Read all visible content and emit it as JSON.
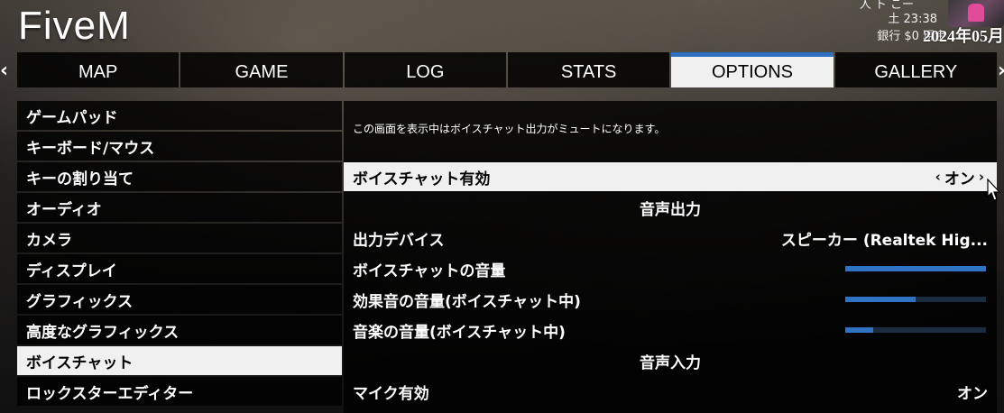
{
  "app": {
    "title": "FiveM"
  },
  "hud": {
    "player_name": "人 ト こー",
    "time": "土 23:38",
    "money": "銀行 $0  現金",
    "date_overlay": "2024年05月"
  },
  "tabs": [
    {
      "label": "MAP",
      "active": false
    },
    {
      "label": "GAME",
      "active": false
    },
    {
      "label": "LOG",
      "active": false
    },
    {
      "label": "STATS",
      "active": false
    },
    {
      "label": "OPTIONS",
      "active": true
    },
    {
      "label": "GALLERY",
      "active": false
    }
  ],
  "nav": {
    "left_arrow": "‹",
    "right_arrow": "›"
  },
  "sidebar": {
    "items": [
      {
        "label": "ゲームパッド"
      },
      {
        "label": "キーボード/マウス"
      },
      {
        "label": "キーの割り当て"
      },
      {
        "label": "オーディオ"
      },
      {
        "label": "カメラ"
      },
      {
        "label": "ディスプレイ"
      },
      {
        "label": "グラフィックス"
      },
      {
        "label": "高度なグラフィックス"
      },
      {
        "label": "ボイスチャット",
        "active": true
      },
      {
        "label": "ロックスターエディター"
      }
    ]
  },
  "panel": {
    "notice": "この画面を表示中はボイスチャット出力がミュートになります。",
    "voice_chat_enabled": {
      "label": "ボイスチャット有効",
      "value": "オン"
    },
    "output_section": "音声出力",
    "output_device": {
      "label": "出力デバイス",
      "value": "スピーカー (Realtek Hig..."
    },
    "voice_volume": {
      "label": "ボイスチャットの音量",
      "level": 1.0
    },
    "sfx_volume": {
      "label": "効果音の音量(ボイスチャット中)",
      "level": 0.5
    },
    "music_volume": {
      "label": "音楽の音量(ボイスチャット中)",
      "level": 0.2
    },
    "input_section": "音声入力",
    "mic_enabled": {
      "label": "マイク有効",
      "value": "オン"
    }
  },
  "colors": {
    "accent": "#2f6fbf",
    "slider_track": "#1b2b40",
    "slider_fill": "#2f73c2",
    "highlight_bg": "#f0f0f0"
  }
}
